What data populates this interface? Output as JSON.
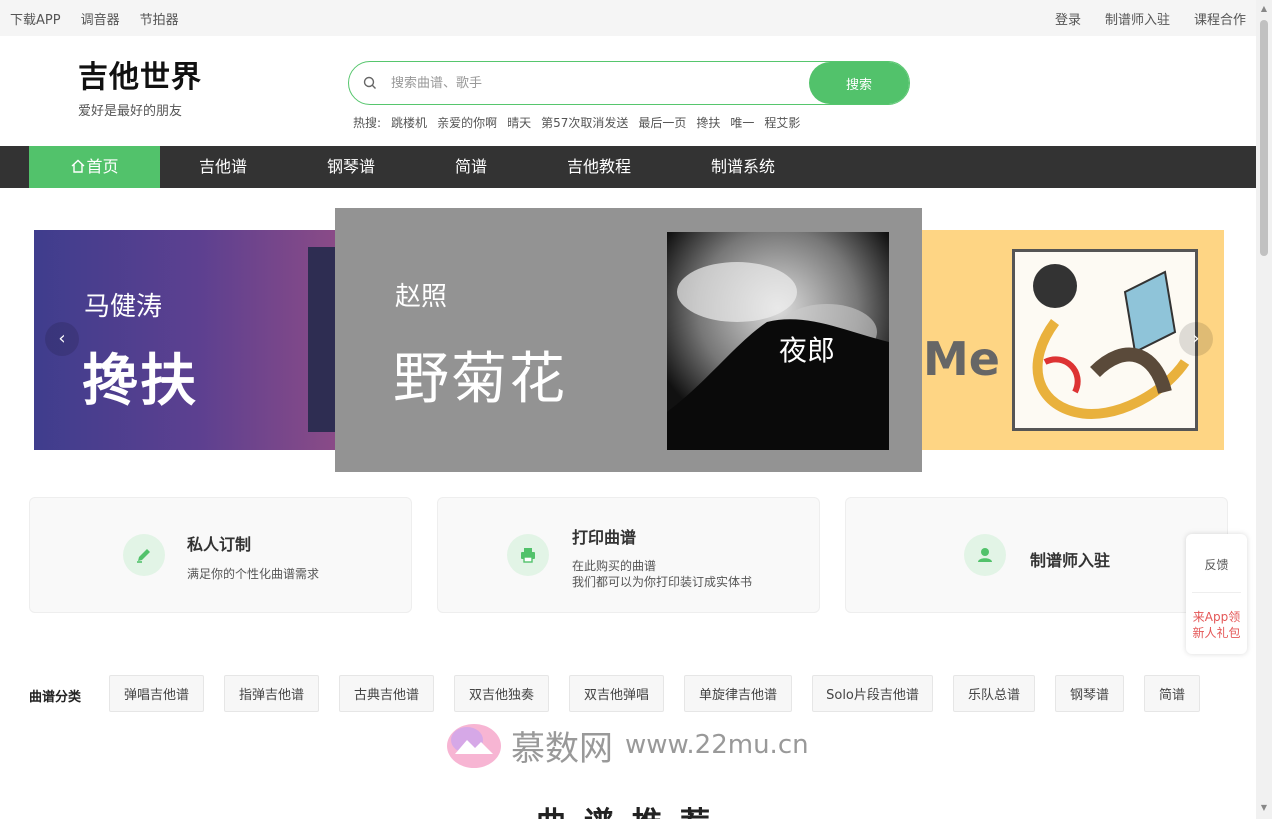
{
  "topbar": {
    "left": [
      "下载APP",
      "调音器",
      "节拍器"
    ],
    "right": [
      "登录",
      "制谱师入驻",
      "课程合作"
    ]
  },
  "header": {
    "brand": "吉他世界",
    "slogan": "爱好是最好的朋友",
    "search": {
      "placeholder": "搜索曲谱、歌手",
      "button": "搜索"
    },
    "hot_label": "热搜:",
    "hot_items": [
      "跳楼机",
      "亲爱的你啊",
      "晴天",
      "第57次取消发送",
      "最后一页",
      "搀扶",
      "唯一",
      "程艾影"
    ]
  },
  "nav": {
    "items": [
      "首页",
      "吉他谱",
      "钢琴谱",
      "简谱",
      "吉他教程",
      "制谱系统"
    ],
    "active_color": "#52c26b"
  },
  "carousel": {
    "left": {
      "artist": "马健涛",
      "song": "搀扶"
    },
    "center": {
      "artist": "赵照",
      "song": "野菊花",
      "cover_text": "夜郎"
    },
    "right": {
      "title": "Me"
    },
    "prev": "‹",
    "next": "›"
  },
  "features": [
    {
      "title": "私人订制",
      "desc": [
        "满足你的个性化曲谱需求"
      ],
      "icon": "pencil-icon"
    },
    {
      "title": "打印曲谱",
      "desc": [
        "在此购买的曲谱",
        "我们都可以为你打印装订成实体书"
      ],
      "icon": "printer-icon"
    },
    {
      "title": "制谱师入驻",
      "desc": [],
      "icon": "user-icon"
    }
  ],
  "float": {
    "feedback": "反馈",
    "gift": [
      "来App领",
      "新人礼包"
    ]
  },
  "categories": {
    "label": "曲谱分类",
    "items": [
      "弹唱吉他谱",
      "指弹吉他谱",
      "古典吉他谱",
      "双吉他独奏",
      "双吉他弹唱",
      "单旋律吉他谱",
      "Solo片段吉他谱",
      "乐队总谱",
      "钢琴谱",
      "简谱"
    ]
  },
  "watermark": {
    "name": "慕数网",
    "url": "www.22mu.cn"
  },
  "section_title": "曲谱推荐",
  "colors": {
    "accent": "#52c26b",
    "nav_bg": "#333333"
  }
}
